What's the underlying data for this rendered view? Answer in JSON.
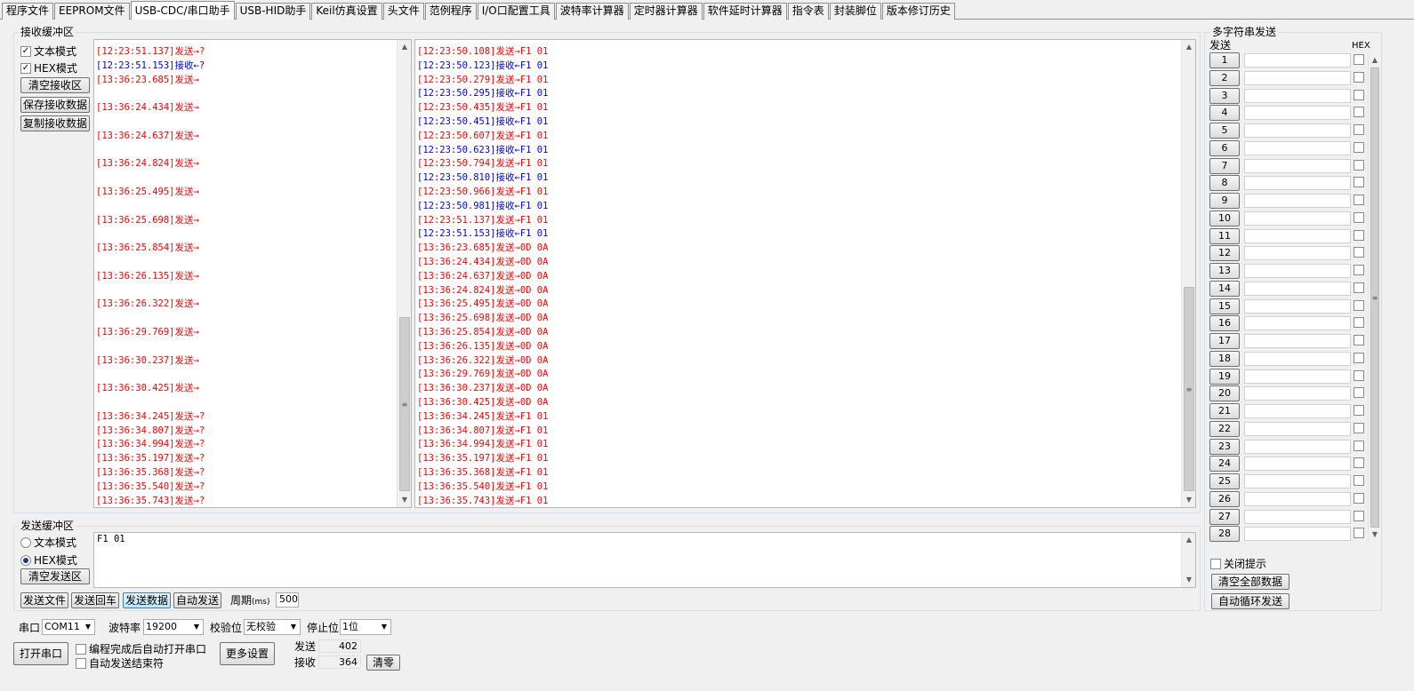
{
  "tabs": [
    "程序文件",
    "EEPROM文件",
    "USB-CDC/串口助手",
    "USB-HID助手",
    "Keil仿真设置",
    "头文件",
    "范例程序",
    "I/O口配置工具",
    "波特率计算器",
    "定时器计算器",
    "软件延时计算器",
    "指令表",
    "封装脚位",
    "版本修订历史"
  ],
  "active_tab": 2,
  "receive": {
    "group_label": "接收缓冲区",
    "text_mode_label": "文本模式",
    "hex_mode_label": "HEX模式",
    "text_mode_checked": true,
    "hex_mode_checked": true,
    "clear_btn": "清空接收区",
    "save_btn": "保存接收数据",
    "copy_btn": "复制接收数据",
    "left_log": [
      {
        "text": "[12:23:51.137]发送→?",
        "color": "red"
      },
      {
        "text": "[12:23:51.153]接收←?",
        "color": "blue"
      },
      {
        "text": "[13:36:23.685]发送→",
        "color": "red"
      },
      {
        "text": "",
        "color": "red"
      },
      {
        "text": "[13:36:24.434]发送→",
        "color": "red"
      },
      {
        "text": "",
        "color": "red"
      },
      {
        "text": "[13:36:24.637]发送→",
        "color": "red"
      },
      {
        "text": "",
        "color": "red"
      },
      {
        "text": "[13:36:24.824]发送→",
        "color": "red"
      },
      {
        "text": "",
        "color": "red"
      },
      {
        "text": "[13:36:25.495]发送→",
        "color": "red"
      },
      {
        "text": "",
        "color": "red"
      },
      {
        "text": "[13:36:25.698]发送→",
        "color": "red"
      },
      {
        "text": "",
        "color": "red"
      },
      {
        "text": "[13:36:25.854]发送→",
        "color": "red"
      },
      {
        "text": "",
        "color": "red"
      },
      {
        "text": "[13:36:26.135]发送→",
        "color": "red"
      },
      {
        "text": "",
        "color": "red"
      },
      {
        "text": "[13:36:26.322]发送→",
        "color": "red"
      },
      {
        "text": "",
        "color": "red"
      },
      {
        "text": "[13:36:29.769]发送→",
        "color": "red"
      },
      {
        "text": "",
        "color": "red"
      },
      {
        "text": "[13:36:30.237]发送→",
        "color": "red"
      },
      {
        "text": "",
        "color": "red"
      },
      {
        "text": "[13:36:30.425]发送→",
        "color": "red"
      },
      {
        "text": "",
        "color": "red"
      },
      {
        "text": "[13:36:34.245]发送→?",
        "color": "red"
      },
      {
        "text": "[13:36:34.807]发送→?",
        "color": "red"
      },
      {
        "text": "[13:36:34.994]发送→?",
        "color": "red"
      },
      {
        "text": "[13:36:35.197]发送→?",
        "color": "red"
      },
      {
        "text": "[13:36:35.368]发送→?",
        "color": "red"
      },
      {
        "text": "[13:36:35.540]发送→?",
        "color": "red"
      },
      {
        "text": "[13:36:35.743]发送→?",
        "color": "red"
      }
    ],
    "right_log": [
      {
        "text": "[12:23:50.108]发送→F1 01",
        "color": "red"
      },
      {
        "text": "[12:23:50.123]接收←F1 01",
        "color": "blue"
      },
      {
        "text": "[12:23:50.279]发送→F1 01",
        "color": "red"
      },
      {
        "text": "[12:23:50.295]接收←F1 01",
        "color": "blue"
      },
      {
        "text": "[12:23:50.435]发送→F1 01",
        "color": "red"
      },
      {
        "text": "[12:23:50.451]接收←F1 01",
        "color": "blue"
      },
      {
        "text": "[12:23:50.607]发送→F1 01",
        "color": "red"
      },
      {
        "text": "[12:23:50.623]接收←F1 01",
        "color": "blue"
      },
      {
        "text": "[12:23:50.794]发送→F1 01",
        "color": "red"
      },
      {
        "text": "[12:23:50.810]接收←F1 01",
        "color": "blue"
      },
      {
        "text": "[12:23:50.966]发送→F1 01",
        "color": "red"
      },
      {
        "text": "[12:23:50.981]接收←F1 01",
        "color": "blue"
      },
      {
        "text": "[12:23:51.137]发送→F1 01",
        "color": "red"
      },
      {
        "text": "[12:23:51.153]接收←F1 01",
        "color": "blue"
      },
      {
        "text": "[13:36:23.685]发送→0D 0A",
        "color": "red"
      },
      {
        "text": "[13:36:24.434]发送→0D 0A",
        "color": "red"
      },
      {
        "text": "[13:36:24.637]发送→0D 0A",
        "color": "red"
      },
      {
        "text": "[13:36:24.824]发送→0D 0A",
        "color": "red"
      },
      {
        "text": "[13:36:25.495]发送→0D 0A",
        "color": "red"
      },
      {
        "text": "[13:36:25.698]发送→0D 0A",
        "color": "red"
      },
      {
        "text": "[13:36:25.854]发送→0D 0A",
        "color": "red"
      },
      {
        "text": "[13:36:26.135]发送→0D 0A",
        "color": "red"
      },
      {
        "text": "[13:36:26.322]发送→0D 0A",
        "color": "red"
      },
      {
        "text": "[13:36:29.769]发送→0D 0A",
        "color": "red"
      },
      {
        "text": "[13:36:30.237]发送→0D 0A",
        "color": "red"
      },
      {
        "text": "[13:36:30.425]发送→0D 0A",
        "color": "red"
      },
      {
        "text": "[13:36:34.245]发送→F1 01",
        "color": "red"
      },
      {
        "text": "[13:36:34.807]发送→F1 01",
        "color": "red"
      },
      {
        "text": "[13:36:34.994]发送→F1 01",
        "color": "red"
      },
      {
        "text": "[13:36:35.197]发送→F1 01",
        "color": "red"
      },
      {
        "text": "[13:36:35.368]发送→F1 01",
        "color": "red"
      },
      {
        "text": "[13:36:35.540]发送→F1 01",
        "color": "red"
      },
      {
        "text": "[13:36:35.743]发送→F1 01",
        "color": "red"
      }
    ]
  },
  "send": {
    "group_label": "发送缓冲区",
    "text_mode_label": "文本模式",
    "hex_mode_label": "HEX模式",
    "selected_mode": "hex",
    "clear_btn": "清空发送区",
    "content": "F1 01",
    "send_file_btn": "发送文件",
    "send_enter_btn": "发送回车",
    "send_data_btn": "发送数据",
    "auto_send_btn": "自动发送",
    "period_label": "周期",
    "period_unit": "(ms)",
    "period_value": "500"
  },
  "port": {
    "port_label": "串口",
    "port_value": "COM11",
    "baud_label": "波特率",
    "baud_value": "19200",
    "parity_label": "校验位",
    "parity_value": "无校验",
    "stop_label": "停止位",
    "stop_value": "1位",
    "open_btn": "打开串口",
    "auto_open_label": "编程完成后自动打开串口",
    "auto_end_label": "自动发送结束符",
    "more_btn": "更多设置",
    "sent_label": "发送",
    "sent_value": "402",
    "recv_label": "接收",
    "recv_value": "364",
    "clear_count_btn": "清零"
  },
  "multi": {
    "group_label": "多字符串发送",
    "send_header": "发送",
    "hex_header": "HEX",
    "rows": [
      "1",
      "2",
      "3",
      "4",
      "5",
      "6",
      "7",
      "8",
      "9",
      "10",
      "11",
      "12",
      "13",
      "14",
      "15",
      "16",
      "17",
      "18",
      "19",
      "20",
      "21",
      "22",
      "23",
      "24",
      "25",
      "26",
      "27",
      "28"
    ],
    "close_tip_label": "关闭提示",
    "clear_all_btn": "清空全部数据",
    "auto_loop_btn": "自动循环发送"
  }
}
